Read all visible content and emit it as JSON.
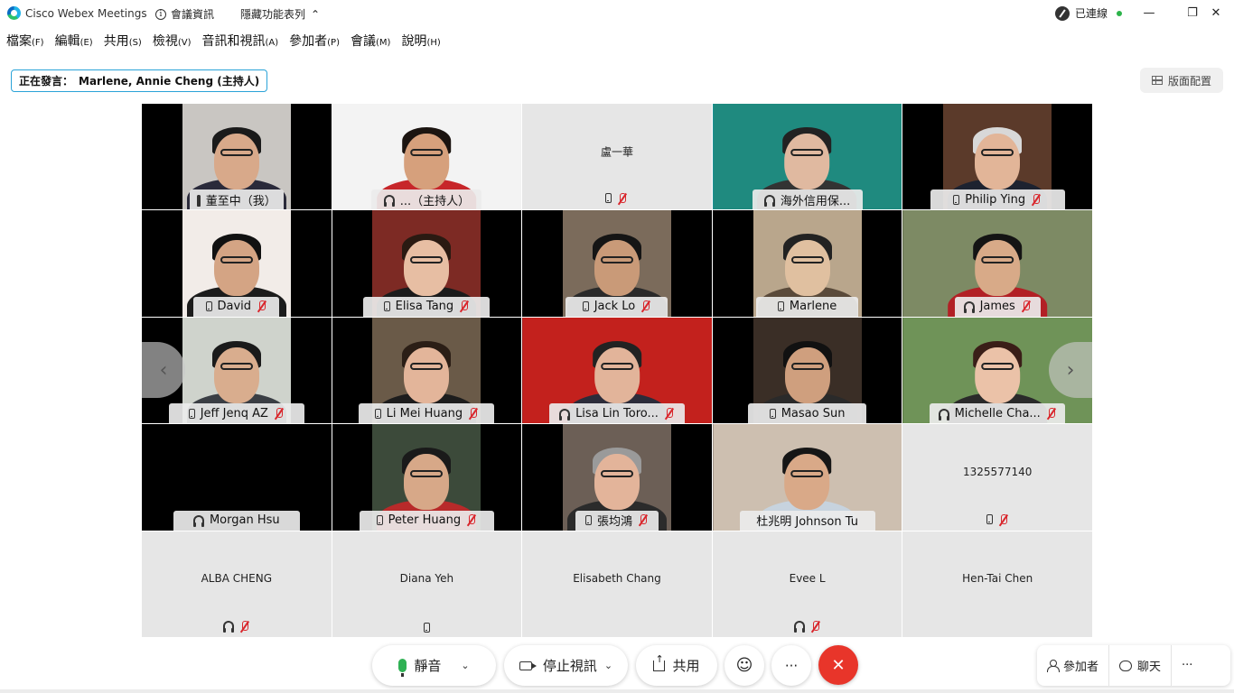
{
  "window": {
    "app_title": "Cisco Webex Meetings",
    "meeting_info": "會議資訊",
    "hide_menu": "隱藏功能表列",
    "connection_status": "已連線"
  },
  "menu": [
    {
      "label": "檔案",
      "key": "(F)"
    },
    {
      "label": "編輯",
      "key": "(E)"
    },
    {
      "label": "共用",
      "key": "(S)"
    },
    {
      "label": "檢視",
      "key": "(V)"
    },
    {
      "label": "音訊和視訊",
      "key": "(A)"
    },
    {
      "label": "參加者",
      "key": "(P)"
    },
    {
      "label": "會議",
      "key": "(M)"
    },
    {
      "label": "說明",
      "key": "(H)"
    }
  ],
  "speaking": {
    "prefix": "正在發言：",
    "names": "Marlene, Annie Cheng (主持人)"
  },
  "layout_button": "版面配置",
  "participants": [
    {
      "name": "董至中（我）",
      "audio": "headset",
      "muted": false,
      "video": true,
      "active": false,
      "bg": "#c9c6c2",
      "skin": "#d8a98a",
      "shirt": "#2a2a3a",
      "hair": "#1a1a1a"
    },
    {
      "name": "...（主持人）",
      "audio": "headset",
      "muted": false,
      "video": true,
      "active": true,
      "bg": "#f3f3f3",
      "skin": "#d6a07c",
      "shirt": "#c7262a",
      "hair": "#1b1410"
    },
    {
      "name": "盧一華",
      "audio": "phone",
      "muted": true,
      "video": false,
      "active": false
    },
    {
      "name": "海外信用保...",
      "audio": "headset",
      "muted": false,
      "video": true,
      "active": true,
      "bg": "#1f8a7f",
      "skin": "#e0b9a0",
      "shirt": "#333",
      "hair": "#222"
    },
    {
      "name": "Philip Ying",
      "audio": "phone",
      "muted": true,
      "video": true,
      "active": false,
      "bg": "#5b3a2a",
      "skin": "#e2b598",
      "shirt": "#1d2230",
      "hair": "#d8d8d8"
    },
    {
      "name": "David",
      "audio": "phone",
      "muted": true,
      "video": true,
      "active": false,
      "bg": "#f2ece8",
      "skin": "#d4a484",
      "shirt": "#1c1c1c",
      "hair": "#111"
    },
    {
      "name": "Elisa Tang",
      "audio": "phone",
      "muted": true,
      "video": true,
      "active": false,
      "bg": "#7d2a24",
      "skin": "#e7bea3",
      "shirt": "#1b1b1b",
      "hair": "#2a1a12"
    },
    {
      "name": "Jack Lo",
      "audio": "phone",
      "muted": true,
      "video": true,
      "active": false,
      "bg": "#7b6b5b",
      "skin": "#c99a78",
      "shirt": "#2a2a2a",
      "hair": "#151515"
    },
    {
      "name": "Marlene",
      "audio": "phone",
      "muted": false,
      "video": true,
      "active": false,
      "bg": "#b9a68c",
      "skin": "#e0c0a0",
      "shirt": "#5a4a3a",
      "hair": "#222"
    },
    {
      "name": "James",
      "audio": "headset",
      "muted": true,
      "video": true,
      "active": false,
      "bg": "#7d8a64",
      "skin": "#d8aa88",
      "shirt": "#b22025",
      "hair": "#141414"
    },
    {
      "name": "Jeff Jenq AZ",
      "audio": "phone",
      "muted": true,
      "video": true,
      "active": false,
      "bg": "#cfd3cc",
      "skin": "#d9ad8e",
      "shirt": "#3a3e44",
      "hair": "#1a1a1a"
    },
    {
      "name": "Li Mei Huang",
      "audio": "phone",
      "muted": true,
      "video": true,
      "active": false,
      "bg": "#6a5a48",
      "skin": "#e3b59a",
      "shirt": "#1d1d1d",
      "hair": "#2b1e16"
    },
    {
      "name": "Lisa Lin Toro...",
      "audio": "headset",
      "muted": true,
      "video": true,
      "active": false,
      "bg": "#c3211d",
      "skin": "#e2b49a",
      "shirt": "#2c2c3a",
      "hair": "#222"
    },
    {
      "name": "Masao Sun",
      "audio": "phone",
      "muted": false,
      "video": true,
      "active": false,
      "bg": "#3a2e26",
      "skin": "#cf9f7e",
      "shirt": "#2a2a2a",
      "hair": "#111"
    },
    {
      "name": "Michelle Cha...",
      "audio": "headset",
      "muted": true,
      "video": true,
      "active": false,
      "bg": "#6f9358",
      "skin": "#ebc2a8",
      "shirt": "#2a2a2a",
      "hair": "#3a1e18"
    },
    {
      "name": "Morgan Hsu",
      "audio": "headset",
      "muted": false,
      "video": true,
      "active": false,
      "bg": "#000000",
      "skin": "#000000",
      "shirt": "#000000",
      "hair": "#000000"
    },
    {
      "name": "Peter Huang",
      "audio": "phone",
      "muted": true,
      "video": true,
      "active": false,
      "bg": "#3c4a3a",
      "skin": "#d7a888",
      "shirt": "#b82a2a",
      "hair": "#1a1a1a"
    },
    {
      "name": "張均鴻",
      "audio": "phone",
      "muted": true,
      "video": true,
      "active": false,
      "bg": "#6c5f56",
      "skin": "#e3b49a",
      "shirt": "#2b2b2b",
      "hair": "#9a9a9a"
    },
    {
      "name": "杜兆明 Johnson Tu",
      "audio": "none",
      "muted": false,
      "video": true,
      "active": false,
      "bg": "#cdbfb0",
      "skin": "#d9a988",
      "shirt": "#c7d3de",
      "hair": "#161616"
    },
    {
      "name": "1325577140",
      "audio": "phone",
      "muted": true,
      "video": false,
      "active": false
    },
    {
      "name": "ALBA CHENG",
      "audio": "headset",
      "muted": true,
      "video": false,
      "active": false
    },
    {
      "name": "Diana Yeh",
      "audio": "phone",
      "muted": false,
      "video": false,
      "active": false
    },
    {
      "name": "Elisabeth Chang",
      "audio": "none",
      "muted": false,
      "video": false,
      "active": false
    },
    {
      "name": "Evee L",
      "audio": "headset",
      "muted": true,
      "video": false,
      "active": false
    },
    {
      "name": "Hen-Tai Chen",
      "audio": "none",
      "muted": false,
      "video": false,
      "active": false
    }
  ],
  "toolbar": {
    "mute_label": "靜音",
    "stop_video_label": "停止視訊",
    "share_label": "共用",
    "participants_label": "參加者",
    "chat_label": "聊天"
  }
}
